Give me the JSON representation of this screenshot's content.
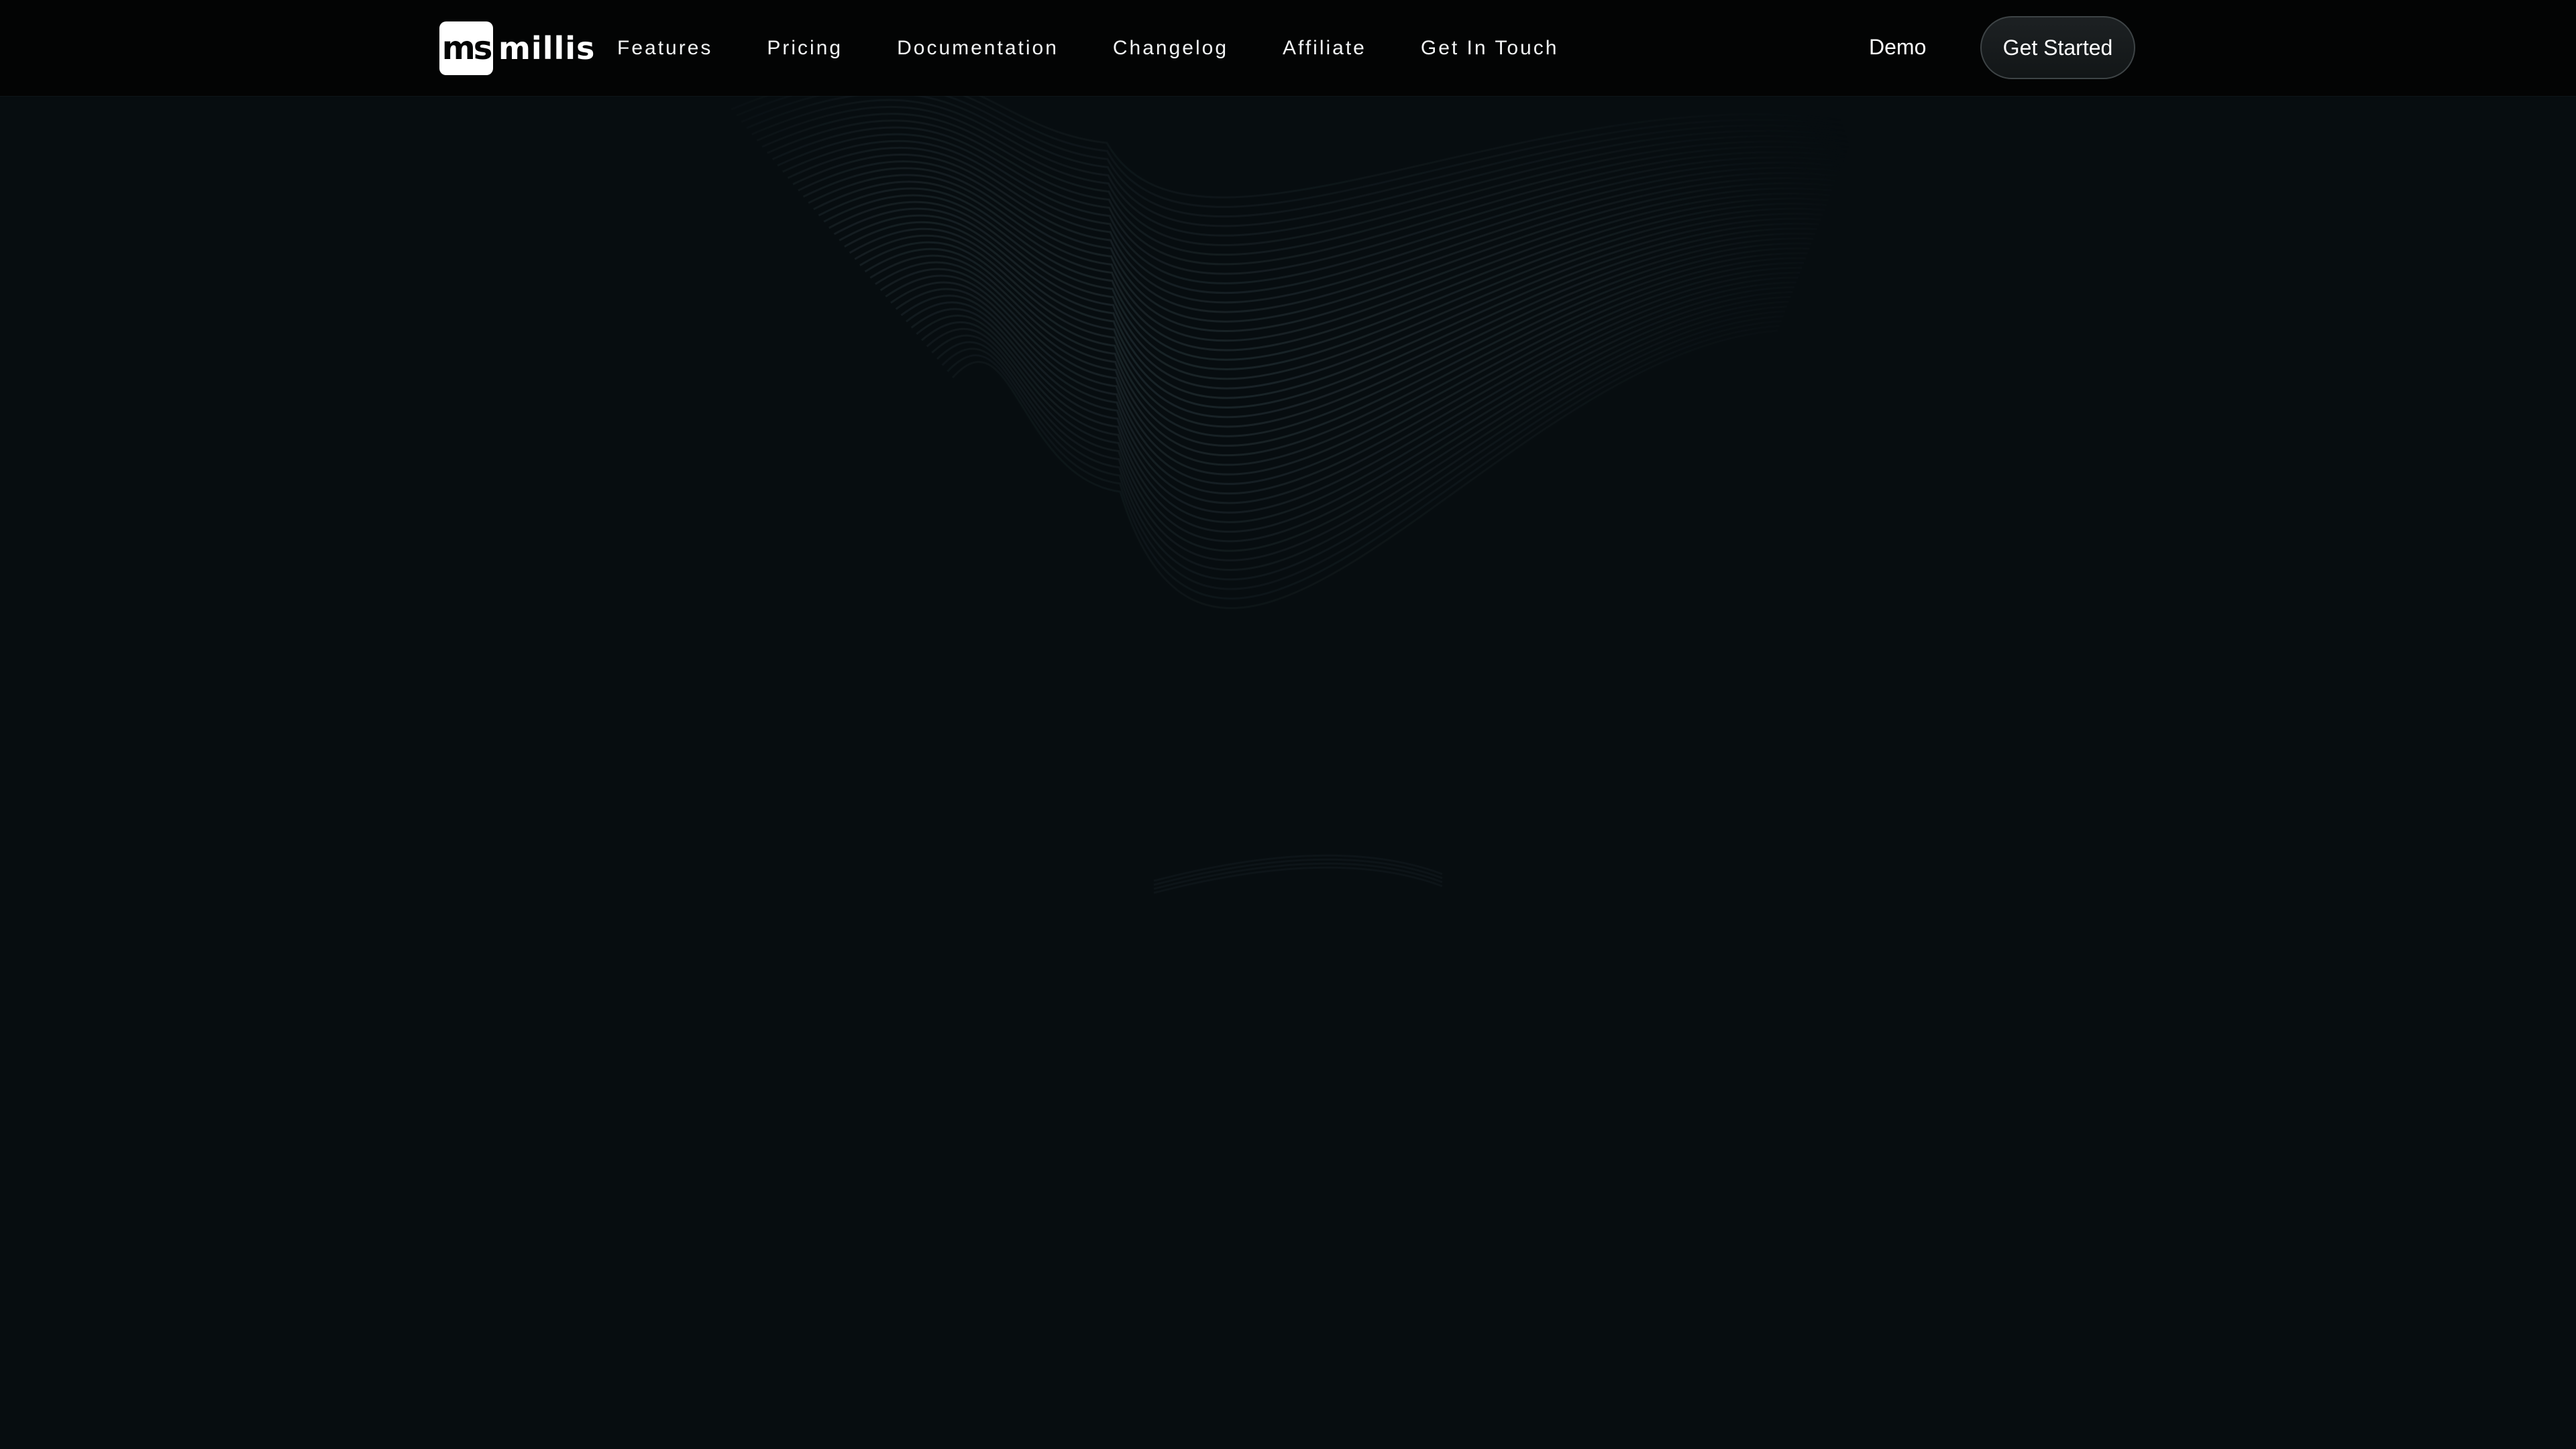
{
  "brand": {
    "logo_mark": "ms",
    "name": "millis"
  },
  "nav": {
    "links": [
      {
        "label": "Features"
      },
      {
        "label": "Pricing"
      },
      {
        "label": "Documentation"
      },
      {
        "label": "Changelog"
      },
      {
        "label": "Affiliate"
      },
      {
        "label": "Get In Touch"
      }
    ],
    "demo_label": "Demo",
    "cta_label": "Get Started"
  },
  "theme": {
    "background": "#070d10",
    "navbar_background": "#030404",
    "text": "#ffffff",
    "wave_line": "#1f2a2e"
  },
  "hero": {
    "decoration": "wave-lines-background"
  }
}
